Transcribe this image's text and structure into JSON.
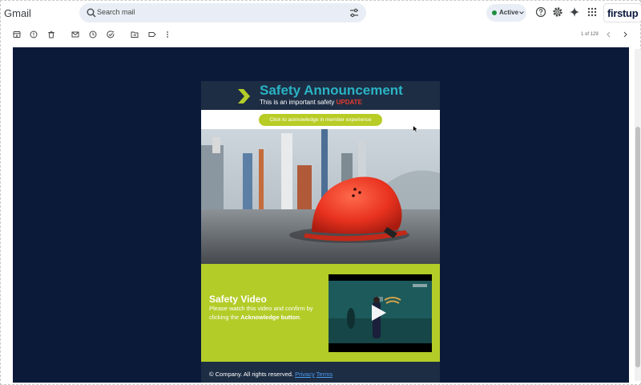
{
  "app": {
    "name": "Gmail"
  },
  "search": {
    "placeholder": "Search mail"
  },
  "status": {
    "label": "Active"
  },
  "brand": {
    "logo_text_main": "firstup",
    "accent_color": "#e8423a"
  },
  "toolbar": {
    "pager": "1 of 129"
  },
  "email": {
    "title": "Safety Announcement",
    "subtitle_prefix": "This is an important safety",
    "subtitle_highlight": "UPDATE",
    "ack_button": "Click to acknowledge in member experience",
    "video_title": "Safety Video",
    "video_desc_prefix": "Please watch this video and confirm by clicking the",
    "video_desc_bold": "Acknowledge button",
    "video_desc_suffix": ".",
    "footer_text": "© Company. All rights reserved.",
    "footer_privacy": "Privacy",
    "footer_terms": "Terms"
  },
  "colors": {
    "page_bg": "#0c1a3a",
    "header_bg": "#1d2d44",
    "title": "#2ab3c4",
    "accent_green": "#b3cc28",
    "update_red": "#e63b2e"
  }
}
